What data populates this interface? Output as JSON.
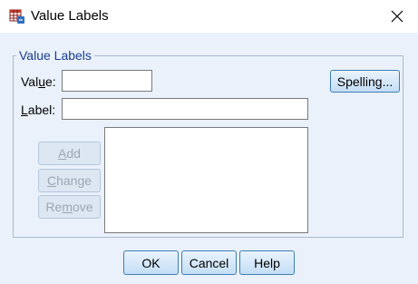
{
  "window": {
    "title": "Value Labels",
    "icon": "spss-grid-icon",
    "close_glyph": "✕"
  },
  "group": {
    "legend": "Value Labels",
    "value_label_pre": "Val",
    "value_label_mnemonic": "u",
    "value_label_post": "e:",
    "value_input": "",
    "label_label_mnemonic": "L",
    "label_label_post": "abel:",
    "label_input": "",
    "spelling_button": "Spelling...",
    "add_mnemonic": "A",
    "add_rest": "dd",
    "change_mnemonic": "C",
    "change_rest": "hange",
    "remove_pre": "Re",
    "remove_mnemonic": "m",
    "remove_post": "ove",
    "list_items": []
  },
  "footer": {
    "ok": "OK",
    "cancel": "Cancel",
    "help": "Help"
  }
}
